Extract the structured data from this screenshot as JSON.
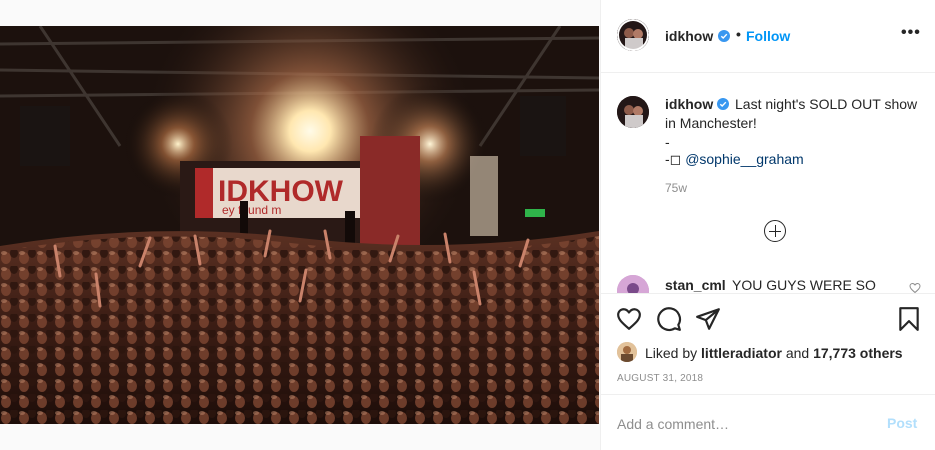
{
  "post": {
    "author": "idkhow",
    "follow_label": "Follow",
    "separator": "•",
    "more_label": "•••",
    "banner_text": "IDKHOW",
    "banner_sub": "ey found m"
  },
  "caption": {
    "username": "idkhow",
    "line1": "Last night's SOLD OUT show",
    "line2": "in Manchester!",
    "line3": "-",
    "line4_prefix": "-◻ ",
    "mention": "@sophie__graham",
    "age": "75w"
  },
  "comment": {
    "username": "stan_cml",
    "text": "YOU GUYS WERE SO"
  },
  "likes": {
    "prefix": "Liked by ",
    "liker": "littleradiator",
    "middle": " and ",
    "count": "17,773 others"
  },
  "date": "AUGUST 31, 2018",
  "add_comment": {
    "placeholder": "Add a comment…",
    "post_label": "Post"
  },
  "icons": {
    "verified": "verified-badge-icon",
    "like": "heart-icon",
    "comment": "comment-bubble-icon",
    "share": "paper-plane-icon",
    "save": "bookmark-icon",
    "load_more": "plus-circle-icon",
    "more": "more-options-icon"
  },
  "colors": {
    "link": "#0095f6",
    "mention": "#00376b",
    "post_disabled": "#b2dffc",
    "verified": "#3897f0"
  }
}
